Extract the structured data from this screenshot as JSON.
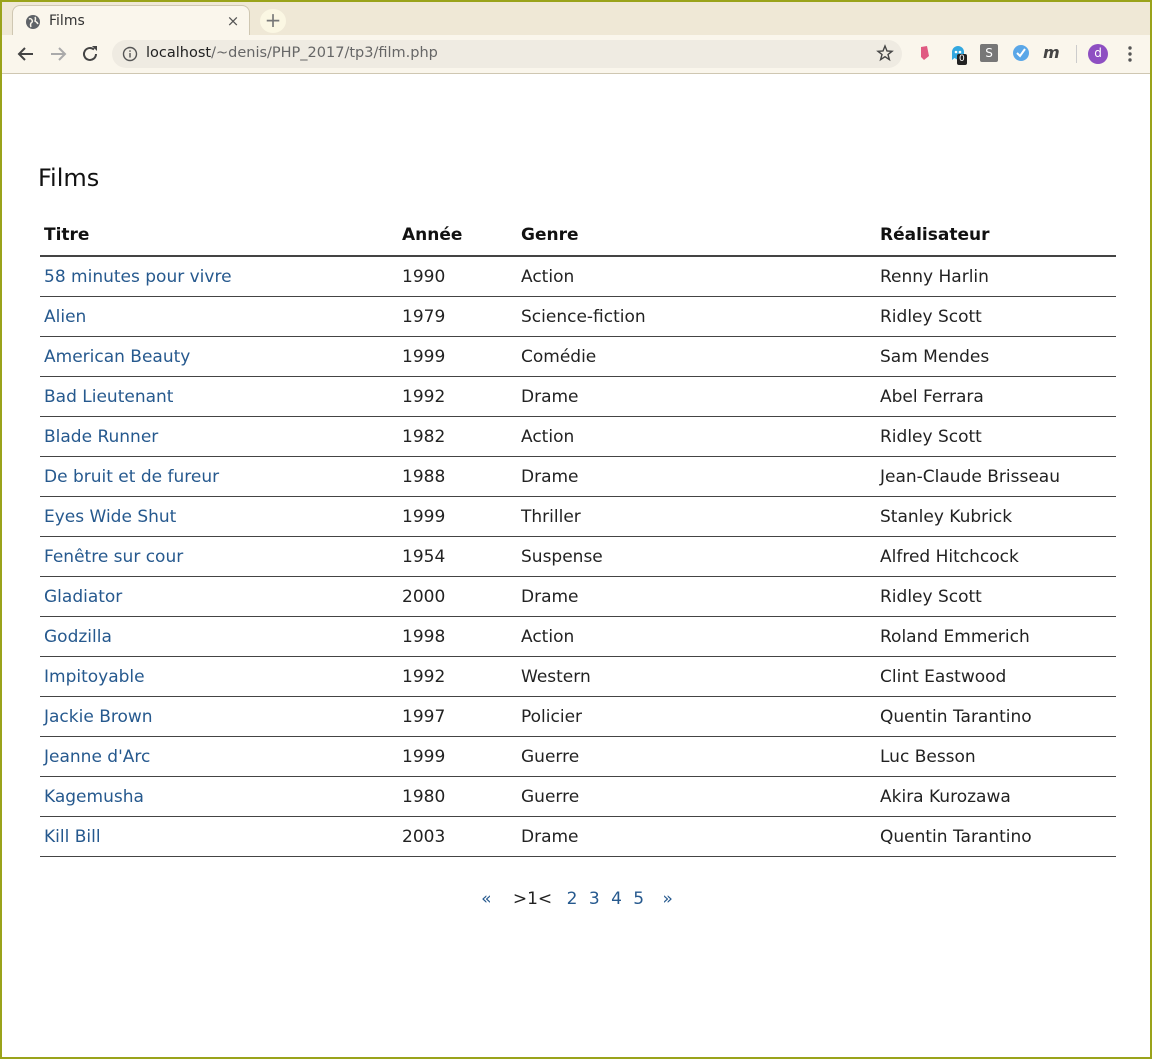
{
  "browser": {
    "tab_title": "Films",
    "tab_close": "×",
    "new_tab": "+",
    "url_host": "localhost",
    "url_path": "/~denis/PHP_2017/tp3/film.php",
    "extension_badge": "0",
    "extension_s": "S",
    "extension_m": "m",
    "avatar_letter": "d"
  },
  "page": {
    "title": "Films",
    "columns": [
      "Titre",
      "Année",
      "Genre",
      "Réalisateur"
    ],
    "rows": [
      [
        "58 minutes pour vivre",
        "1990",
        "Action",
        "Renny Harlin"
      ],
      [
        "Alien",
        "1979",
        "Science-fiction",
        "Ridley Scott"
      ],
      [
        "American Beauty",
        "1999",
        "Comédie",
        "Sam Mendes"
      ],
      [
        "Bad Lieutenant",
        "1992",
        "Drame",
        "Abel Ferrara"
      ],
      [
        "Blade Runner",
        "1982",
        "Action",
        "Ridley Scott"
      ],
      [
        "De bruit et de fureur",
        "1988",
        "Drame",
        "Jean-Claude Brisseau"
      ],
      [
        "Eyes Wide Shut",
        "1999",
        "Thriller",
        "Stanley Kubrick"
      ],
      [
        "Fenêtre sur cour",
        "1954",
        "Suspense",
        "Alfred Hitchcock"
      ],
      [
        "Gladiator",
        "2000",
        "Drame",
        "Ridley Scott"
      ],
      [
        "Godzilla",
        "1998",
        "Action",
        "Roland Emmerich"
      ],
      [
        "Impitoyable",
        "1992",
        "Western",
        "Clint Eastwood"
      ],
      [
        "Jackie Brown",
        "1997",
        "Policier",
        "Quentin Tarantino"
      ],
      [
        "Jeanne d'Arc",
        "1999",
        "Guerre",
        "Luc Besson"
      ],
      [
        "Kagemusha",
        "1980",
        "Guerre",
        "Akira Kurozawa"
      ],
      [
        "Kill Bill",
        "2003",
        "Drame",
        "Quentin Tarantino"
      ]
    ],
    "pagination": {
      "first": "«",
      "current": ">1<",
      "pages": [
        "2",
        "3",
        "4",
        "5"
      ],
      "last": "»"
    }
  },
  "colors": {
    "link": "#26598e",
    "frame_border": "#9aa31a",
    "tab_strip": "#efe8d6"
  }
}
